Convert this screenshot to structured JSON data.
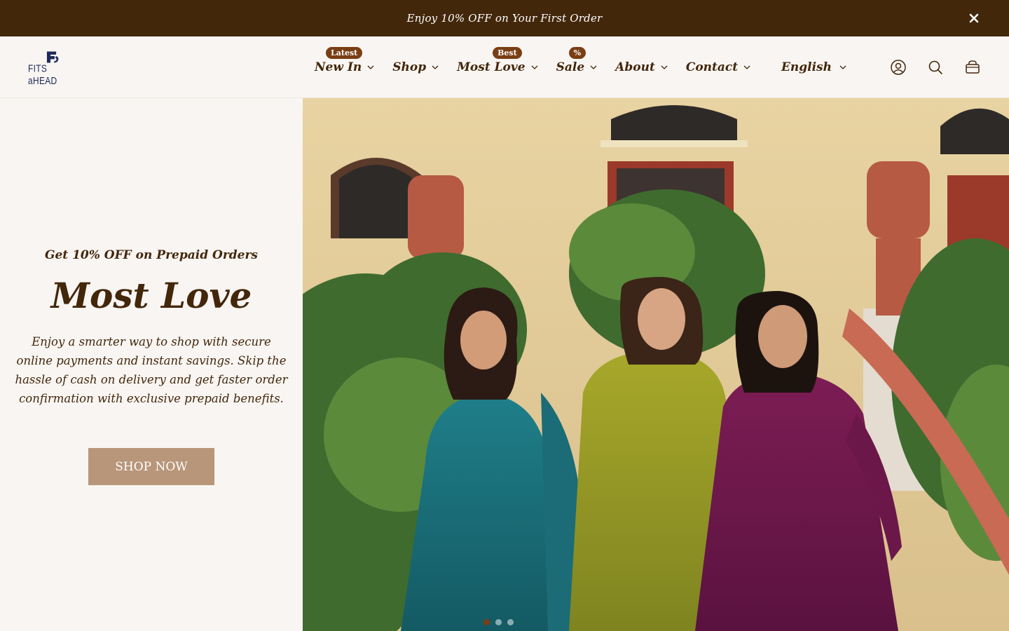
{
  "announcement": {
    "text": "Enjoy 10% OFF on Your First Order",
    "close_icon": "close-icon"
  },
  "header": {
    "logo_text": "FITS aHEAD",
    "nav": [
      {
        "label": "New In",
        "badge": "Latest"
      },
      {
        "label": "Shop",
        "badge": ""
      },
      {
        "label": "Most Love",
        "badge": "Best"
      },
      {
        "label": "Sale",
        "badge": "%"
      },
      {
        "label": "About",
        "badge": ""
      },
      {
        "label": "Contact",
        "badge": ""
      }
    ],
    "language": "English",
    "icons": [
      "account-icon",
      "search-icon",
      "cart-icon"
    ]
  },
  "hero": {
    "kicker": "Get 10% OFF on Prepaid Orders",
    "title": "Most Love",
    "description": "Enjoy a smarter way to shop with secure online payments and instant savings. Skip the hassle of cash on delivery and get faster order confirmation with exclusive prepaid benefits.",
    "cta": "SHOP NOW",
    "slide_count": 3,
    "active_slide": 1
  },
  "colors": {
    "brand_brown": "#43270b",
    "badge": "#7a3e14",
    "button": "#b8967a",
    "background": "#f8f5f2",
    "logo_navy": "#1e2a5a"
  }
}
